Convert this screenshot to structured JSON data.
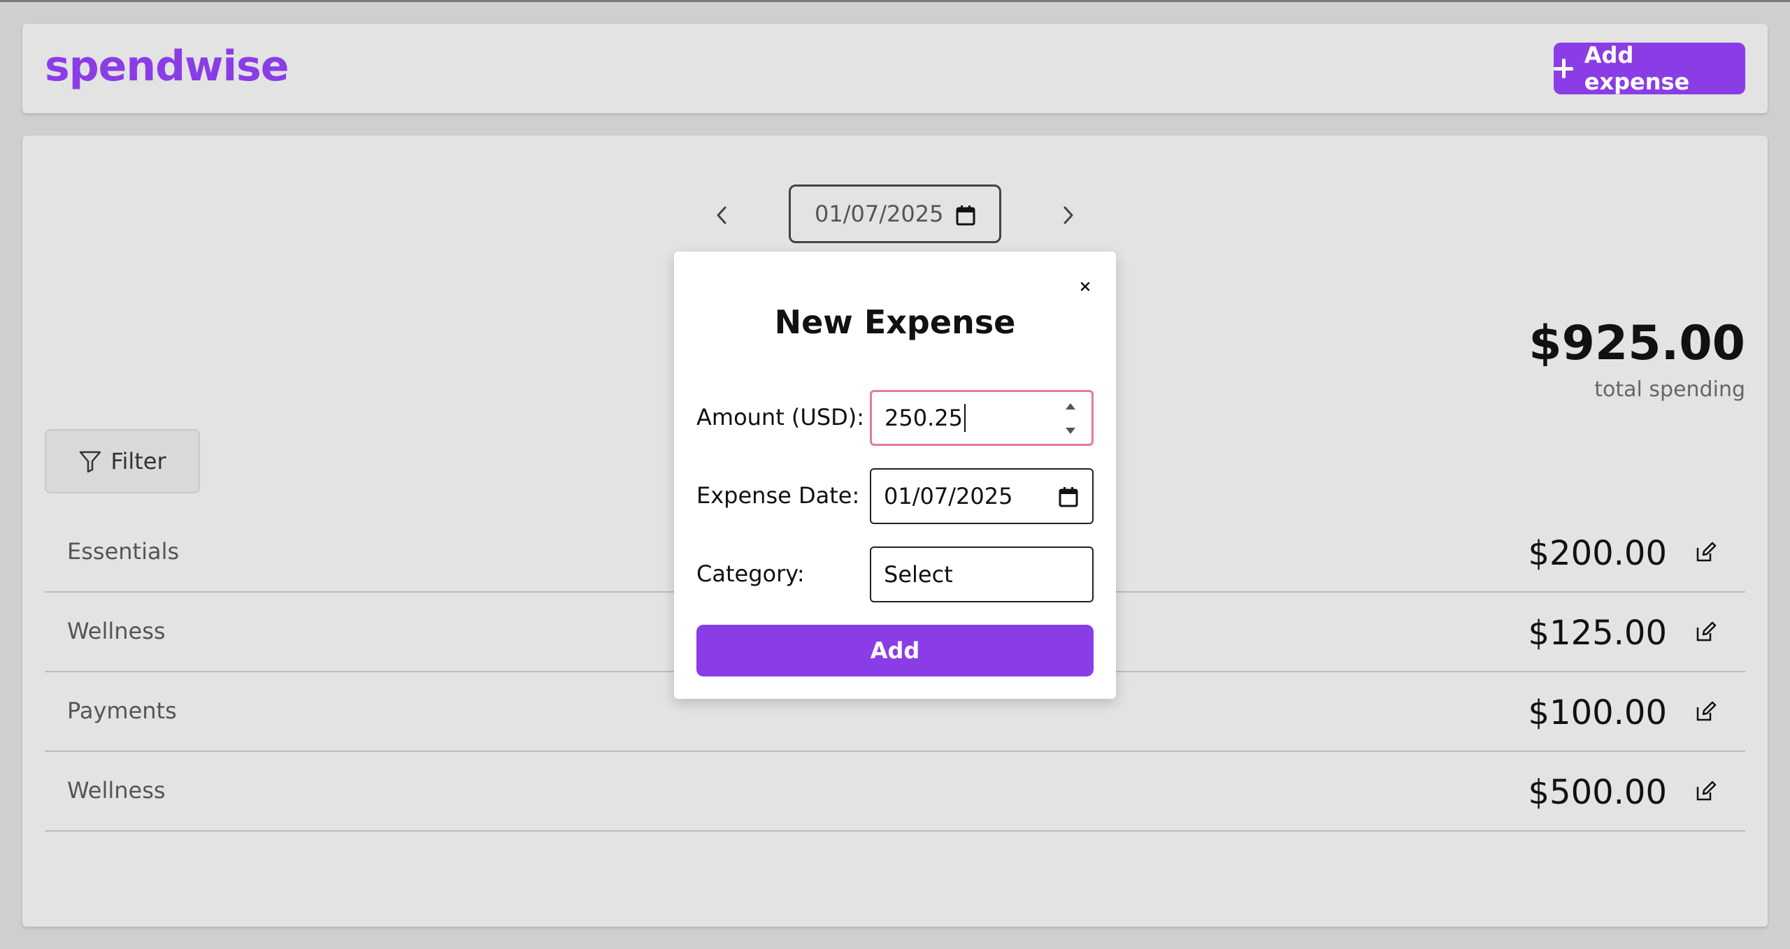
{
  "header": {
    "brand": "spendwise",
    "add_expense_label": "Add expense"
  },
  "date_nav": {
    "current_date": "01/07/2025"
  },
  "summary": {
    "total": "$925.00",
    "total_label": "total spending"
  },
  "filter": {
    "label": "Filter"
  },
  "expenses": [
    {
      "category": "Essentials",
      "amount": "$200.00"
    },
    {
      "category": "Wellness",
      "amount": "$125.00"
    },
    {
      "category": "Payments",
      "amount": "$100.00"
    },
    {
      "category": "Wellness",
      "amount": "$500.00"
    }
  ],
  "modal": {
    "close_glyph": "×",
    "title": "New Expense",
    "amount_label": "Amount (USD):",
    "amount_value": "250.25",
    "date_label": "Expense Date:",
    "date_value": "01/07/2025",
    "category_label": "Category:",
    "category_value": "Select",
    "submit_label": "Add"
  },
  "colors": {
    "brand": "#8a3de6",
    "focus_border": "#e27aa8",
    "card_bg": "#e3e3e3"
  }
}
